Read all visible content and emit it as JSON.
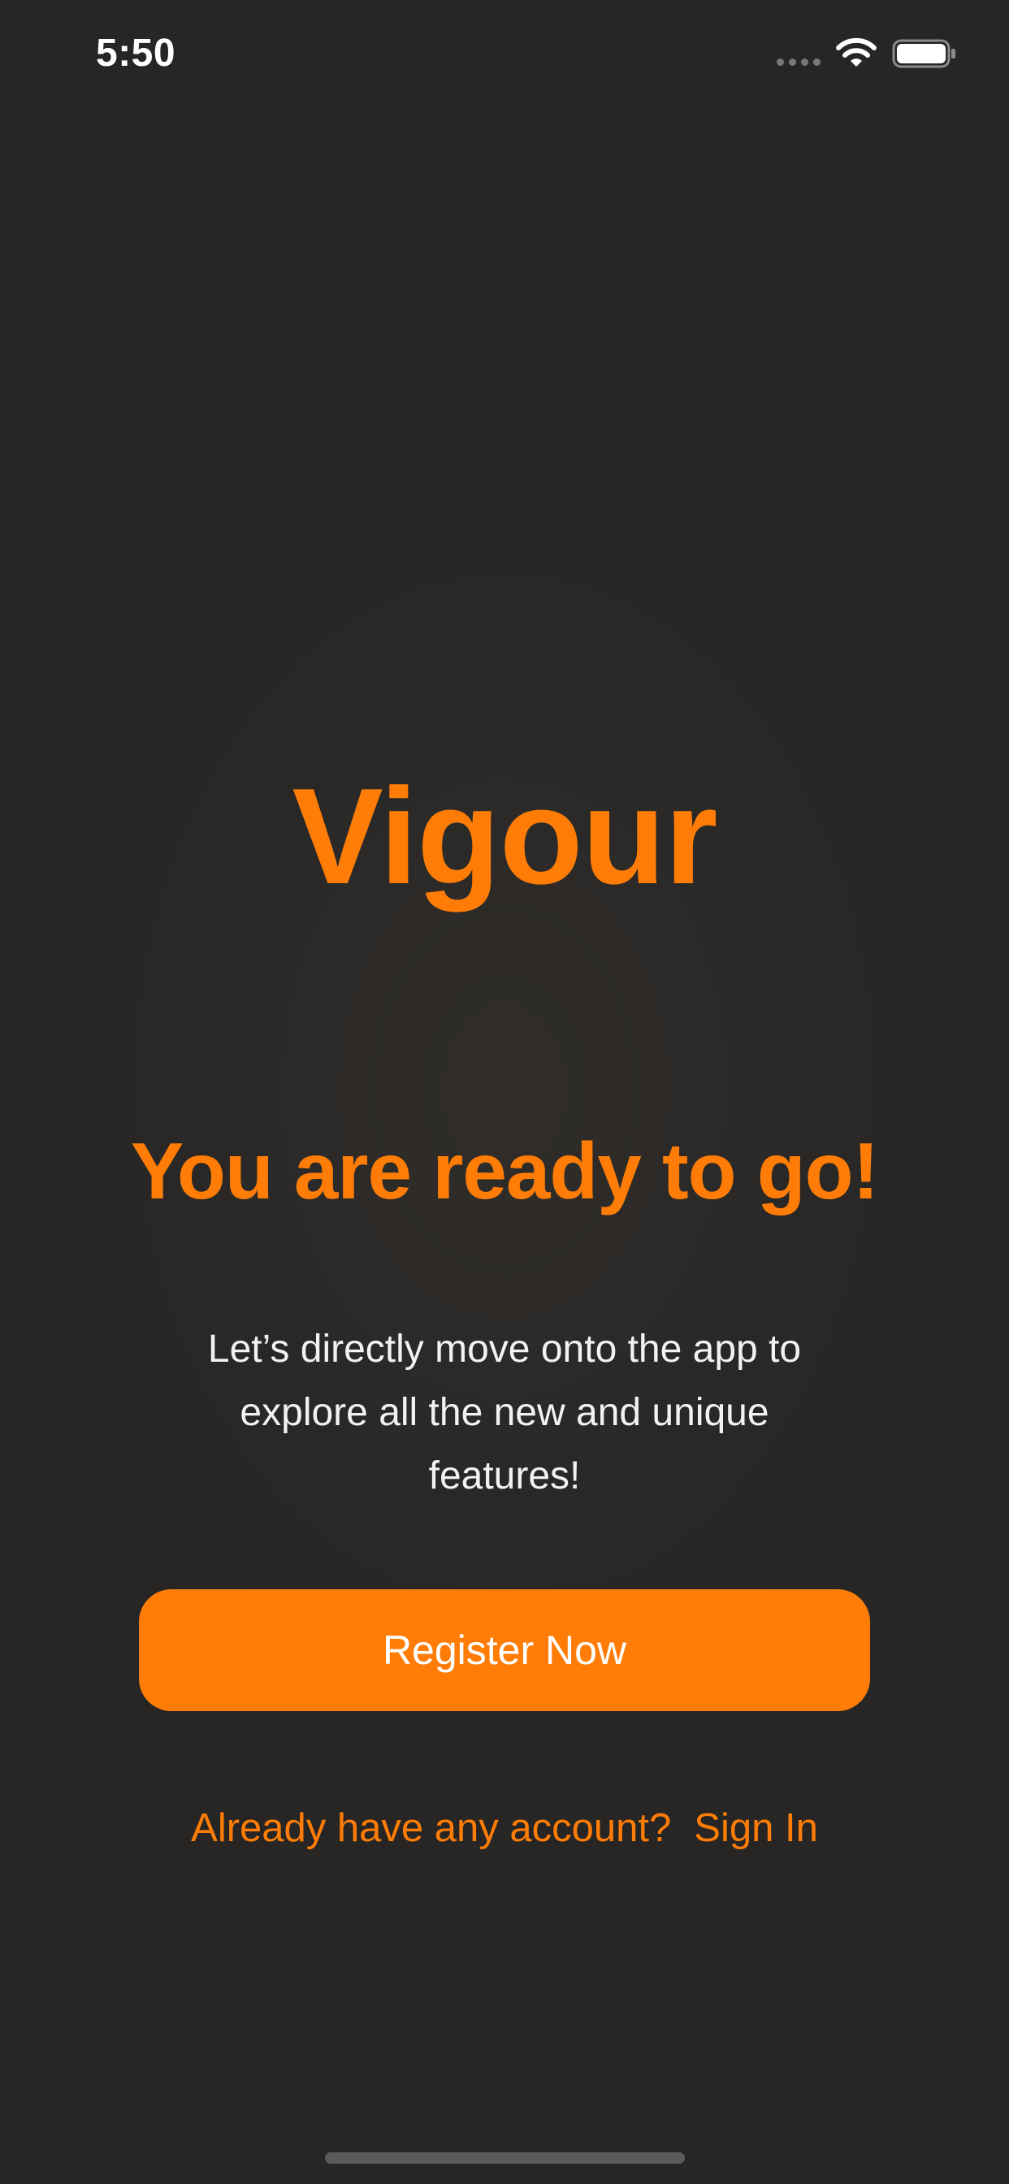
{
  "status_bar": {
    "time": "5:50",
    "signal_icon": "signal-dots-icon",
    "wifi_icon": "wifi-icon",
    "battery_icon": "battery-icon"
  },
  "app": {
    "title": "Vigour"
  },
  "main": {
    "headline": "You are ready to go!",
    "description": "Let’s directly move onto the app to explore all the new and unique features!",
    "register_label": "Register Now",
    "signin_prompt": "Already have any account?",
    "signin_link": "Sign In"
  },
  "colors": {
    "accent": "#FF7D07",
    "background": "#272625",
    "text": "#FFFFFF"
  }
}
